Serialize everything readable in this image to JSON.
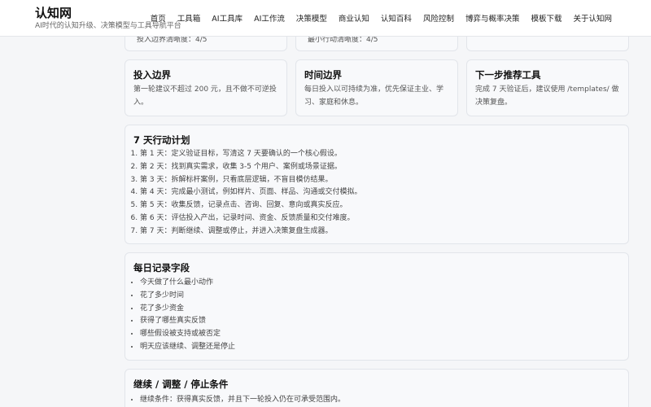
{
  "site": {
    "title": "认知网",
    "subtitle": "AI时代的认知升级、决策模型与工具导航平台"
  },
  "nav": [
    "首页",
    "工具箱",
    "AI工具库",
    "AI工作流",
    "决策模型",
    "商业认知",
    "认知百科",
    "风险控制",
    "博弈与概率决策",
    "模板下载",
    "关于认知网"
  ],
  "partial_top": {
    "left": "投入边界清晰度：4/5",
    "middle": "最小行动清晰度：4/5"
  },
  "boundary_cards": [
    {
      "title": "投入边界",
      "text": "第一轮建议不超过 200 元，且不做不可逆投入。"
    },
    {
      "title": "时间边界",
      "text": "每日投入以可持续为准，优先保证主业、学习、家庭和休息。"
    },
    {
      "title": "下一步推荐工具",
      "text": "完成 7 天验证后，建议使用 /templates/ 做决策复盘。"
    }
  ],
  "plan": {
    "title": "7 天行动计划",
    "steps": [
      "第 1 天：定义验证目标，写清这 7 天要确认的一个核心假设。",
      "第 2 天：找到真实需求，收集 3-5 个用户、案例或场景证据。",
      "第 3 天：拆解标杆案例，只看底层逻辑，不盲目模仿结果。",
      "第 4 天：完成最小测试，例如样片、页面、样品、沟通或交付模拟。",
      "第 5 天：收集反馈，记录点击、咨询、回复、意向或真实反应。",
      "第 6 天：评估投入产出，记录时间、资金、反馈质量和交付难度。",
      "第 7 天：判断继续、调整或停止，并进入决策复盘生成器。"
    ]
  },
  "record": {
    "title": "每日记录字段",
    "items": [
      "今天做了什么最小动作",
      "花了多少时间",
      "花了多少资金",
      "获得了哪些真实反馈",
      "哪些假设被支持或被否定",
      "明天应该继续、调整还是停止"
    ]
  },
  "conditions": {
    "title": "继续 / 调整 / 停止条件",
    "items": [
      "继续条件：获得真实反馈，并且下一轮投入仍在可承受范围内。"
    ]
  }
}
